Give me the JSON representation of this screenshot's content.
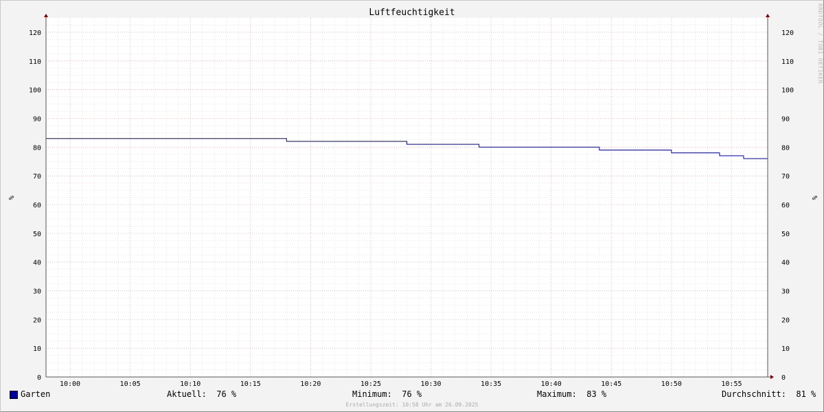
{
  "chart_data": {
    "type": "line",
    "title": "Luftfeuchtigkeit",
    "ylabel_left": "%",
    "ylabel_right": "%",
    "xlim": [
      "09:58",
      "10:58"
    ],
    "ylim": [
      0,
      125
    ],
    "x_ticks": [
      "10:00",
      "10:05",
      "10:10",
      "10:15",
      "10:20",
      "10:25",
      "10:30",
      "10:35",
      "10:40",
      "10:45",
      "10:50",
      "10:55"
    ],
    "y_ticks": [
      0,
      10,
      20,
      30,
      40,
      50,
      60,
      70,
      80,
      90,
      100,
      110,
      120
    ],
    "grid": true,
    "legend_position": "bottom-left",
    "series": [
      {
        "name": "Garten",
        "color": "#0000a0",
        "step": true,
        "x": [
          "09:58",
          "10:18",
          "10:28",
          "10:34",
          "10:36",
          "10:44",
          "10:50",
          "10:54",
          "10:56"
        ],
        "y": [
          83,
          82,
          81,
          80,
          80,
          79,
          78,
          77,
          76
        ]
      }
    ]
  },
  "legend": {
    "series_name": "Garten",
    "aktuell": "Aktuell:  76 %",
    "minimum": "Minimum:  76 %",
    "maximum": "Maximum:  83 %",
    "durchschnitt": "Durchschnitt:  81 %"
  },
  "footer": "Erstellungszeit: 10:58 Uhr am 26.09.2025",
  "watermark": "RRDTOOL / TOBI OETIKER"
}
